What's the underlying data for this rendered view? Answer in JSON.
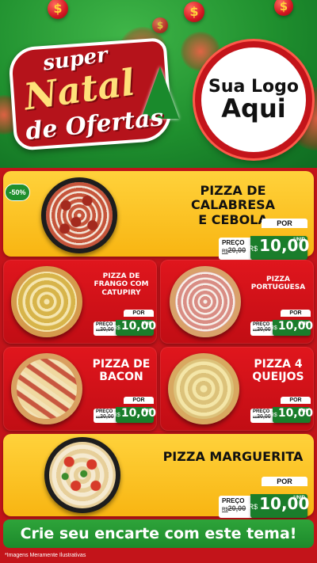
{
  "header": {
    "logo": {
      "line1": "super",
      "line2": "Natal",
      "line3": "de Ofertas"
    },
    "coin_symbol": "$",
    "brand": {
      "line1": "Sua Logo",
      "line2": "Aqui"
    }
  },
  "products": [
    {
      "name_l1": "PIZZA DE CALABRESA",
      "name_l2": "E CEBOLA",
      "badge": "-50%",
      "por": "POR",
      "preco": "PREÇO",
      "old_currency": "R$",
      "old_price": "20,00",
      "currency": "R$",
      "price": "10,00",
      "unit": "UNID"
    },
    {
      "name_l1": "PIZZA DE",
      "name_l2": "FRANGO COM",
      "name_l3": "CATUPIRY",
      "por": "POR",
      "preco": "PREÇO",
      "old_currency": "R$",
      "old_price": "20,00",
      "currency": "R$",
      "price": "10,00",
      "unit": "UNID"
    },
    {
      "name_l1": "PIZZA",
      "name_l2": "PORTUGUESA",
      "por": "POR",
      "preco": "PREÇO",
      "old_currency": "R$",
      "old_price": "20,00",
      "currency": "R$",
      "price": "10,00",
      "unit": "UNID"
    },
    {
      "name_l1": "PIZZA DE",
      "name_l2": "BACON",
      "por": "POR",
      "preco": "PREÇO",
      "old_currency": "R$",
      "old_price": "20,00",
      "currency": "R$",
      "price": "10,00",
      "unit": "UNID"
    },
    {
      "name_l1": "PIZZA 4",
      "name_l2": "QUEIJOS",
      "por": "POR",
      "preco": "PREÇO",
      "old_currency": "R$",
      "old_price": "20,00",
      "currency": "R$",
      "price": "10,00",
      "unit": "UNID"
    },
    {
      "name_l1": "PIZZA MARGUERITA",
      "por": "POR",
      "preco": "PREÇO",
      "old_currency": "R$",
      "old_price": "20,00",
      "currency": "R$",
      "price": "10,00",
      "unit": "UNID"
    }
  ],
  "footer": {
    "cta": "Crie seu encarte com este tema!",
    "disclaimer": "*Imagens Meramente Ilustrativas"
  },
  "colors": {
    "green": "#1f8f2e",
    "red": "#c3141a",
    "yellow": "#ffd23b",
    "price_green": "#1a7d2b"
  }
}
